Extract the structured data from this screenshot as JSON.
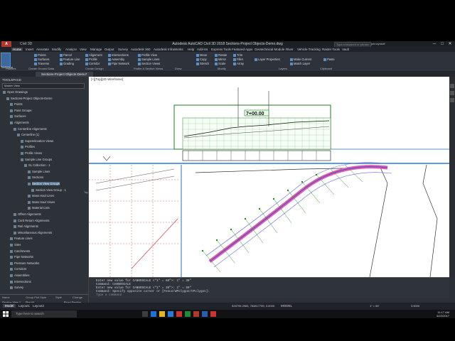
{
  "window": {
    "app_icon_label": "A",
    "quick_access_item": "Civil 3D",
    "title": "Autodesk AutoCAD Civil 3D 2018   Sections-Project Objects-Demo.dwg",
    "search_placeholder": "Type a keyword or phrase",
    "user": "johncyrdoff",
    "min": "─",
    "max": "□",
    "close": "✕"
  },
  "ribbon_tabs": [
    "Home",
    "Insert",
    "Annotate",
    "Modify",
    "Analyze",
    "View",
    "Manage",
    "Output",
    "Survey",
    "Autodesk 360",
    "Autodesk InfraWorks",
    "Help",
    "Add-ins",
    "Express Tools",
    "Featured Apps",
    "Geotechnical Module",
    "River",
    "Vehicle Tracking",
    "Raster Tools",
    "Vault"
  ],
  "active_tab_index": 0,
  "ribbon": {
    "toolspace_label": "Toolspace",
    "buttons": [
      "Points",
      "Surfaces",
      "Traverse",
      "Parcel",
      "Feature Line",
      "Grading",
      "Alignment",
      "Profile",
      "Corridor",
      "Intersections",
      "Assembly",
      "Pipe Network",
      "Profile View",
      "Sample Lines",
      "Section Views",
      "Move",
      "Copy",
      "Stretch",
      "Rotate",
      "Mirror",
      "Scale",
      "Trim",
      "Fillet",
      "Array",
      "Layer Properties",
      "Make Current",
      "Match Layer",
      "Paste"
    ],
    "panels": [
      "Palettes",
      "Create Ground Data",
      "Create Design",
      "Profile & Section Views",
      "Draw",
      "Modify",
      "Layers",
      "Clipboard"
    ]
  },
  "doc_tab": "Sections-Project Objects-Demo*",
  "toolspace": {
    "title": "TOOLSPACE",
    "view": "Master View",
    "tree": [
      {
        "label": "Open Drawings",
        "level": 0
      },
      {
        "label": "Sections-Project Objects-Demo",
        "level": 1
      },
      {
        "label": "Points",
        "level": 2
      },
      {
        "label": "Point Groups",
        "level": 2
      },
      {
        "label": "Surfaces",
        "level": 2
      },
      {
        "label": "Alignments",
        "level": 2
      },
      {
        "label": "Centerline Alignments",
        "level": 3
      },
      {
        "label": "Centerline (1)",
        "level": 4
      },
      {
        "label": "Superelevation Views",
        "level": 5
      },
      {
        "label": "Profiles",
        "level": 5
      },
      {
        "label": "Profile Views",
        "level": 5
      },
      {
        "label": "Sample Line Groups",
        "level": 5
      },
      {
        "label": "SL Collection - 1",
        "level": 6
      },
      {
        "label": "Sample Lines",
        "level": 7
      },
      {
        "label": "Sections",
        "level": 7
      },
      {
        "label": "Section View Groups",
        "level": 7,
        "selected": true
      },
      {
        "label": "Section View Group - 1",
        "level": 8
      },
      {
        "label": "Mass Haul Lines",
        "level": 7
      },
      {
        "label": "Mass Haul Views",
        "level": 7
      },
      {
        "label": "Material Lists",
        "level": 7
      },
      {
        "label": "Offset Alignments",
        "level": 3
      },
      {
        "label": "Curb Return Alignments",
        "level": 3
      },
      {
        "label": "Rail Alignments",
        "level": 3
      },
      {
        "label": "Miscellaneous Alignments",
        "level": 3
      },
      {
        "label": "Feature Lines",
        "level": 2
      },
      {
        "label": "Sites",
        "level": 2
      },
      {
        "label": "Catchments",
        "level": 2
      },
      {
        "label": "Pipe Networks",
        "level": 2
      },
      {
        "label": "Pressure Networks",
        "level": 2
      },
      {
        "label": "Corridors",
        "level": 2
      },
      {
        "label": "Assemblies",
        "level": 2
      },
      {
        "label": "Intersections",
        "level": 2
      },
      {
        "label": "Survey",
        "level": 2
      }
    ],
    "table_headers": [
      "Name",
      "Group Plot Style",
      "Style",
      "Change"
    ],
    "table_row": [
      "Section View 1",
      "Plot All",
      "",
      "Road Section"
    ]
  },
  "drawing": {
    "viewport_label": "[+][Top][2D Wireframe]",
    "station": "7+00.00",
    "side_tabs": [
      "Top",
      "Section",
      "Profile"
    ]
  },
  "command_lines": [
    "Enter new value for CANNOSCALE <\"1\" = 60\">: 1\" = 30\"",
    "Command: CANNOSCALE",
    "Enter new value for CANNOSCALE <\"1\" = 30\">: 1\" = 60\"",
    "Command: Specify opposite corner or [Fence/WPolygon/CPolygon]:"
  ],
  "command_prompt": "Type a command",
  "status": {
    "tabs": [
      "Model",
      "Layout1",
      "Layout2"
    ],
    "coords": "528795.2983, 784817759, 0.0000",
    "mode": "MODEL",
    "scale": "1\" = 60'",
    "decimal": "3.5000"
  },
  "taskbar": {
    "search_placeholder": "Type here to search",
    "time": "11:17 AM",
    "date": "6/22/2017"
  },
  "colors": {
    "accent": "#5b8ec4",
    "ribbon_bg": "#2e333b",
    "canvas": "#ffffff",
    "section_frame": "#1e7a1e"
  }
}
